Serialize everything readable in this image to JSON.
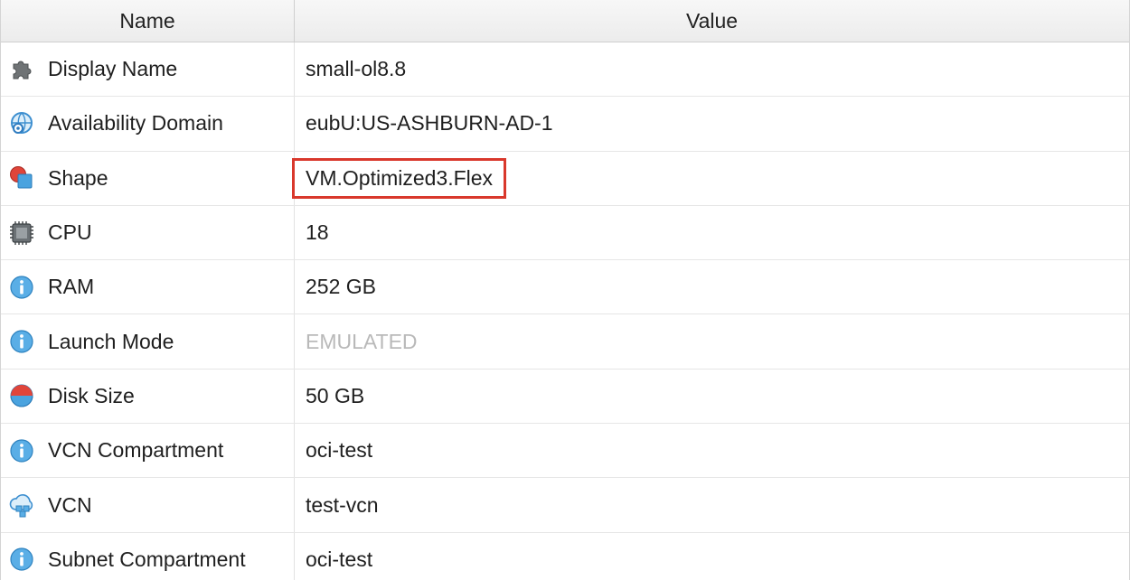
{
  "columns": {
    "name": "Name",
    "value": "Value"
  },
  "rows": [
    {
      "icon": "puzzle-icon",
      "name": "Display Name",
      "value": "small-ol8.8"
    },
    {
      "icon": "globe-gear-icon",
      "name": "Availability Domain",
      "value": "eubU:US-ASHBURN-AD-1"
    },
    {
      "icon": "shape-icon",
      "name": "Shape",
      "value": "VM.Optimized3.Flex",
      "highlighted": true
    },
    {
      "icon": "chip-icon",
      "name": "CPU",
      "value": "18"
    },
    {
      "icon": "info-icon",
      "name": "RAM",
      "value": "252 GB"
    },
    {
      "icon": "info-icon",
      "name": "Launch Mode",
      "value": "EMULATED",
      "muted": true
    },
    {
      "icon": "disk-icon",
      "name": "Disk Size",
      "value": "50 GB"
    },
    {
      "icon": "info-icon",
      "name": "VCN Compartment",
      "value": "oci-test"
    },
    {
      "icon": "cloud-network-icon",
      "name": "VCN",
      "value": "test-vcn"
    },
    {
      "icon": "info-icon",
      "name": "Subnet Compartment",
      "value": "oci-test"
    }
  ],
  "colors": {
    "highlight_border": "#d9382c",
    "muted_text": "#b9b9b9"
  }
}
